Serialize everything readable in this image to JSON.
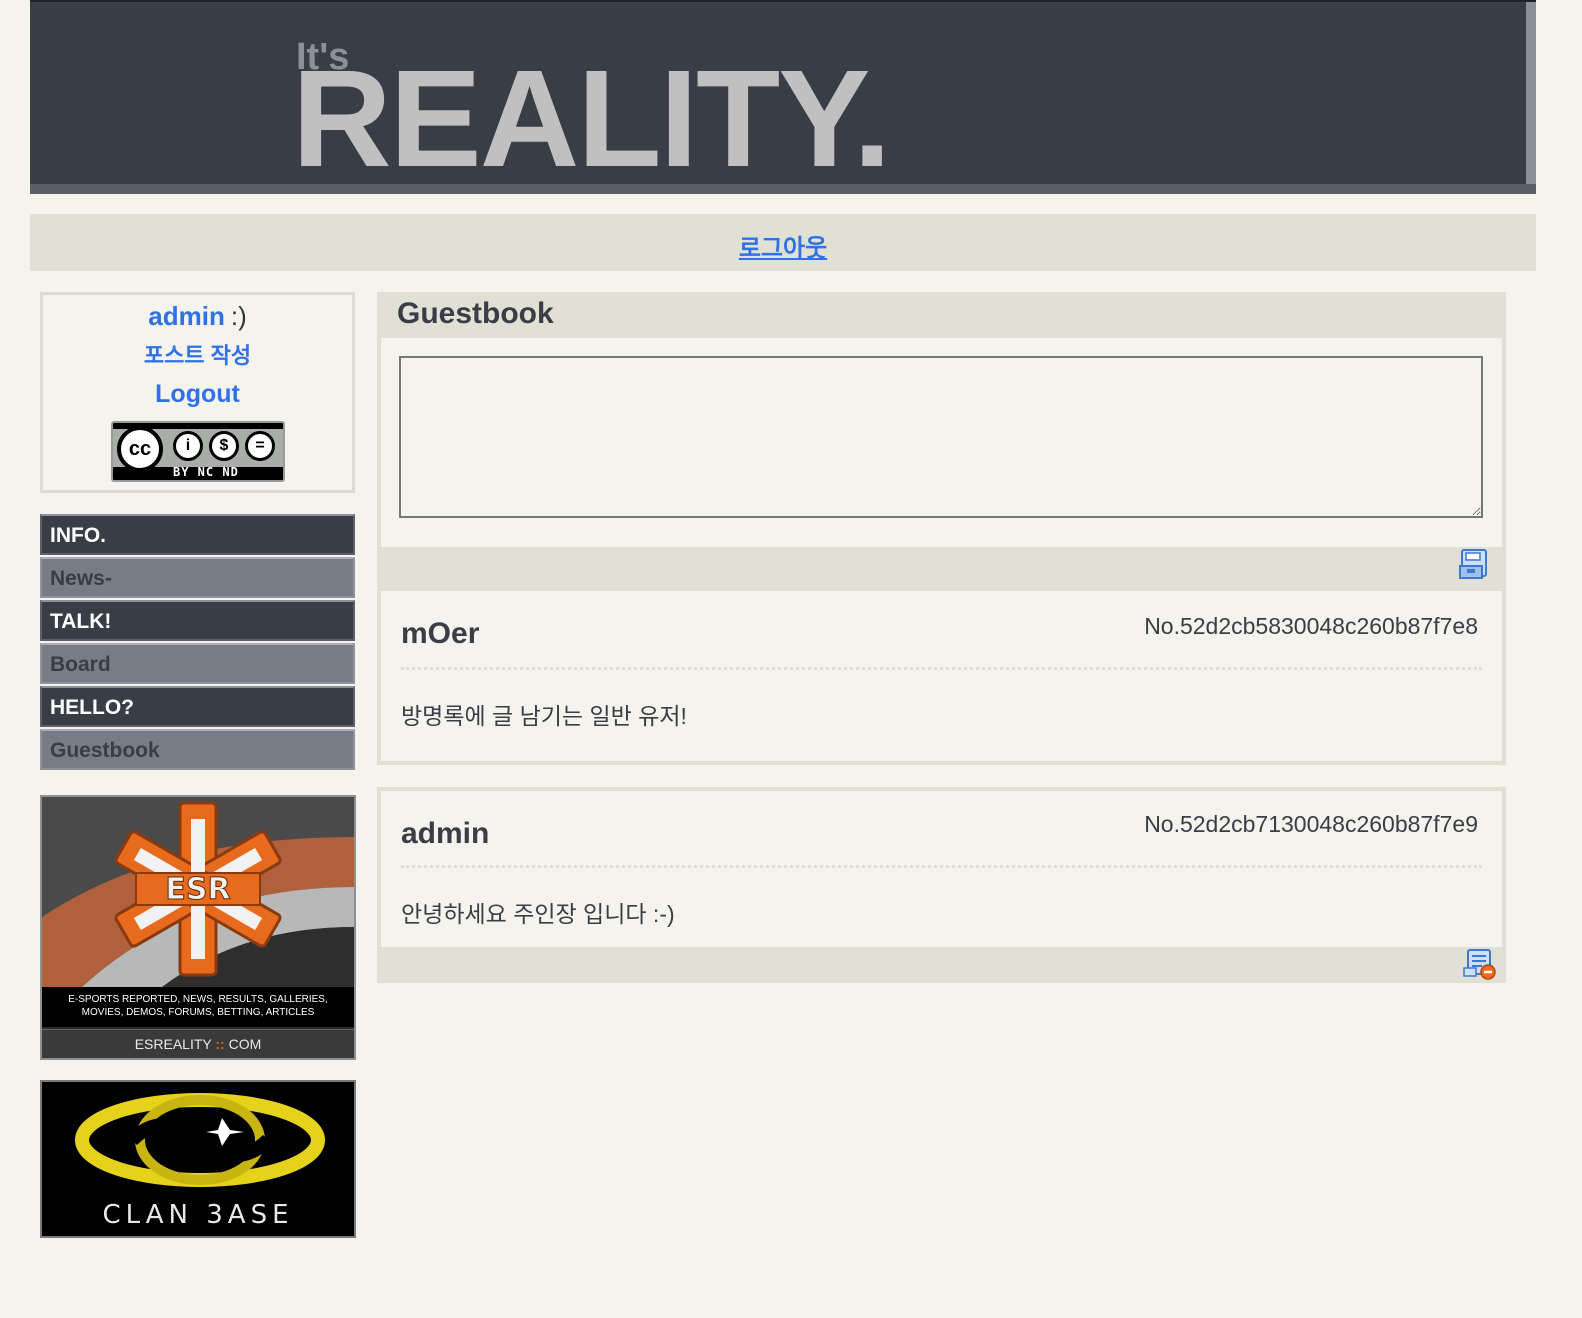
{
  "header": {
    "pre_title": "It's",
    "title": "REALITY."
  },
  "topnav": {
    "logout_label": "로그아웃"
  },
  "userbox": {
    "username": "admin",
    "smile": ":)",
    "write_post": "포스트 작성",
    "logout": "Logout",
    "license_badge": {
      "cc": "cc",
      "labels": "BY  NC  ND"
    }
  },
  "sidemenu": [
    {
      "label": "INFO.",
      "type": "heading"
    },
    {
      "label": "News-",
      "type": "link"
    },
    {
      "label": "TALK!",
      "type": "heading"
    },
    {
      "label": "Board",
      "type": "link"
    },
    {
      "label": "HELLO?",
      "type": "heading"
    },
    {
      "label": "Guestbook",
      "type": "link"
    }
  ],
  "banners": {
    "esr": {
      "logo_text": "ESR",
      "tagline_1": "E-SPORTS REPORTED, NEWS, RESULTS, GALLERIES,",
      "tagline_2": "MOVIES, DEMOS, FORUMS, BETTING, ARTICLES",
      "domain_left": "ESREALITY",
      "domain_sep": "::",
      "domain_right": "COM"
    },
    "clanbase": {
      "wordmark": "CLAN 3ASE"
    }
  },
  "guestbook": {
    "title": "Guestbook",
    "textarea_value": "",
    "submit_icon": "save-icon",
    "entries": [
      {
        "author": "mOer",
        "number": "No.52d2cb5830048c260b87f7e8",
        "message": "방명록에 글 남기는 일반 유저!"
      },
      {
        "author": "admin",
        "number": "No.52d2cb7130048c260b87f7e9",
        "message": "안녕하세요 주인장 입니다 :-)",
        "delete_icon": "delete-icon"
      }
    ]
  },
  "colors": {
    "background": "#f4f3ed",
    "header_bg": "#393d46",
    "panel": "#e1e0d5",
    "link": "#2f71e8",
    "menu_heading": "#393d46",
    "menu_item": "#777c87"
  }
}
